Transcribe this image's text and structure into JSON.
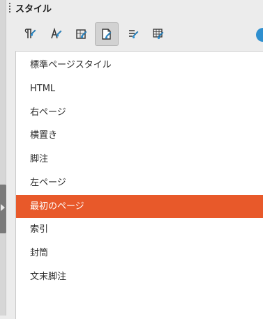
{
  "panel": {
    "title": "スタイル"
  },
  "toolbar": {
    "tools": [
      {
        "icon": "paragraph-style-icon"
      },
      {
        "icon": "character-style-icon"
      },
      {
        "icon": "frame-style-icon"
      },
      {
        "icon": "page-style-icon",
        "active": true
      },
      {
        "icon": "list-style-icon"
      },
      {
        "icon": "table-style-icon"
      }
    ]
  },
  "styles": {
    "items": [
      "標準ページスタイル",
      "HTML",
      "右ページ",
      "横置き",
      "脚注",
      "左ページ",
      "最初のページ",
      "索引",
      "封筒",
      "文末脚注"
    ],
    "selected_index": 6
  },
  "colors": {
    "selection": "#e8592a",
    "icon_stroke": "#333333",
    "icon_accent": "#2e8fcf"
  }
}
